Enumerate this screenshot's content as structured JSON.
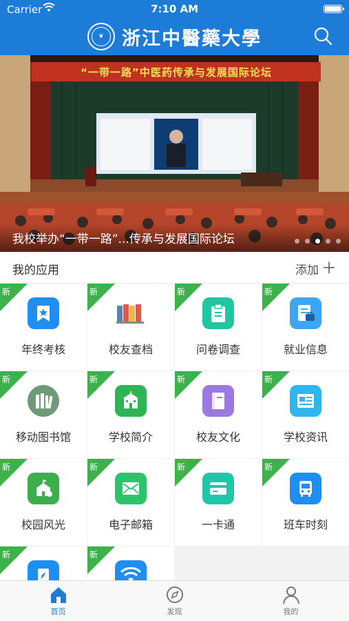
{
  "status_bar": {
    "carrier": "Carrier",
    "time": "7:10 AM"
  },
  "header": {
    "title": "浙江中醫藥大學"
  },
  "banner": {
    "caption": "我校举办“一带一路”...传承与发展国际论坛",
    "backdrop_text": "“一带一路”中医药传承与发展国际论坛",
    "slide_count": 5,
    "active_slide": 3
  },
  "apps_section": {
    "title": "我的应用",
    "add_label": "添加"
  },
  "new_badge_text": "新",
  "apps": [
    {
      "label": "年终考核",
      "icon": "star-bookmark-icon",
      "color": "#1f8ef1"
    },
    {
      "label": "校友查档",
      "icon": "binders-icon",
      "color": "#ffffff"
    },
    {
      "label": "问卷调查",
      "icon": "clipboard-icon",
      "color": "#1fc6a0"
    },
    {
      "label": "就业信息",
      "icon": "resume-briefcase-icon",
      "color": "#3aa6f5"
    },
    {
      "label": "移动图书馆",
      "icon": "books-icon",
      "color": "#6f9a78"
    },
    {
      "label": "学校简介",
      "icon": "school-building-icon",
      "color": "#2fb455"
    },
    {
      "label": "校友文化",
      "icon": "book-icon",
      "color": "#9b79e0"
    },
    {
      "label": "学校资讯",
      "icon": "newspaper-icon",
      "color": "#2fb5f0"
    },
    {
      "label": "校园风光",
      "icon": "campus-icon",
      "color": "#3cae4c"
    },
    {
      "label": "电子邮箱",
      "icon": "mail-icon",
      "color": "#2cc46a"
    },
    {
      "label": "一卡通",
      "icon": "card-icon",
      "color": "#1fc6a8"
    },
    {
      "label": "班车时刻",
      "icon": "bus-icon",
      "color": "#1f8ef1"
    },
    {
      "label": "",
      "icon": "compass-doc-icon",
      "color": "#1f8ef1"
    },
    {
      "label": "",
      "icon": "wifi-icon",
      "color": "#1f8ef1"
    }
  ],
  "tabbar": [
    {
      "label": "首页",
      "icon": "home-icon",
      "active": true
    },
    {
      "label": "发现",
      "icon": "compass-icon",
      "active": false
    },
    {
      "label": "我的",
      "icon": "person-icon",
      "active": false
    }
  ],
  "colors": {
    "primary": "#1c7cd8",
    "new_badge": "#3db14a"
  }
}
